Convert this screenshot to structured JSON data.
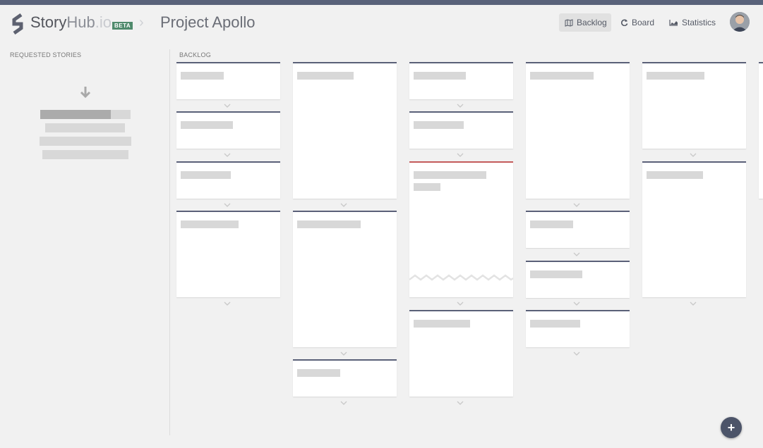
{
  "header": {
    "brand_part1": "Story",
    "brand_part2": "Hub",
    "brand_part3": ".io",
    "beta_badge": "BETA",
    "breadcrumb_separator": "›",
    "project_title": "Project Apollo"
  },
  "nav": {
    "backlog_label": "Backlog",
    "board_label": "Board",
    "statistics_label": "Statistics",
    "active": "Backlog"
  },
  "sections": {
    "requested_label": "REQUESTED STORIES",
    "backlog_label": "BACKLOG"
  },
  "icons": {
    "logo": "storyhub-logo-icon",
    "backlog": "map-icon",
    "board": "refresh-icon",
    "statistics": "area-chart-icon",
    "drop": "arrow-down-icon",
    "expand": "chevron-down-icon",
    "add": "plus-icon"
  },
  "fab": {
    "label": "+"
  },
  "colors": {
    "accent": "#59627a",
    "card_border": "#5a6078",
    "card_alert": "#c45a5a",
    "beta_badge": "#4f8a6c",
    "fab": "#4c5469",
    "background": "#f1f1f1"
  },
  "backlog": {
    "columns": 6,
    "story_cards": 18,
    "highlighted_card": "red top border (column 3, card 3)"
  }
}
